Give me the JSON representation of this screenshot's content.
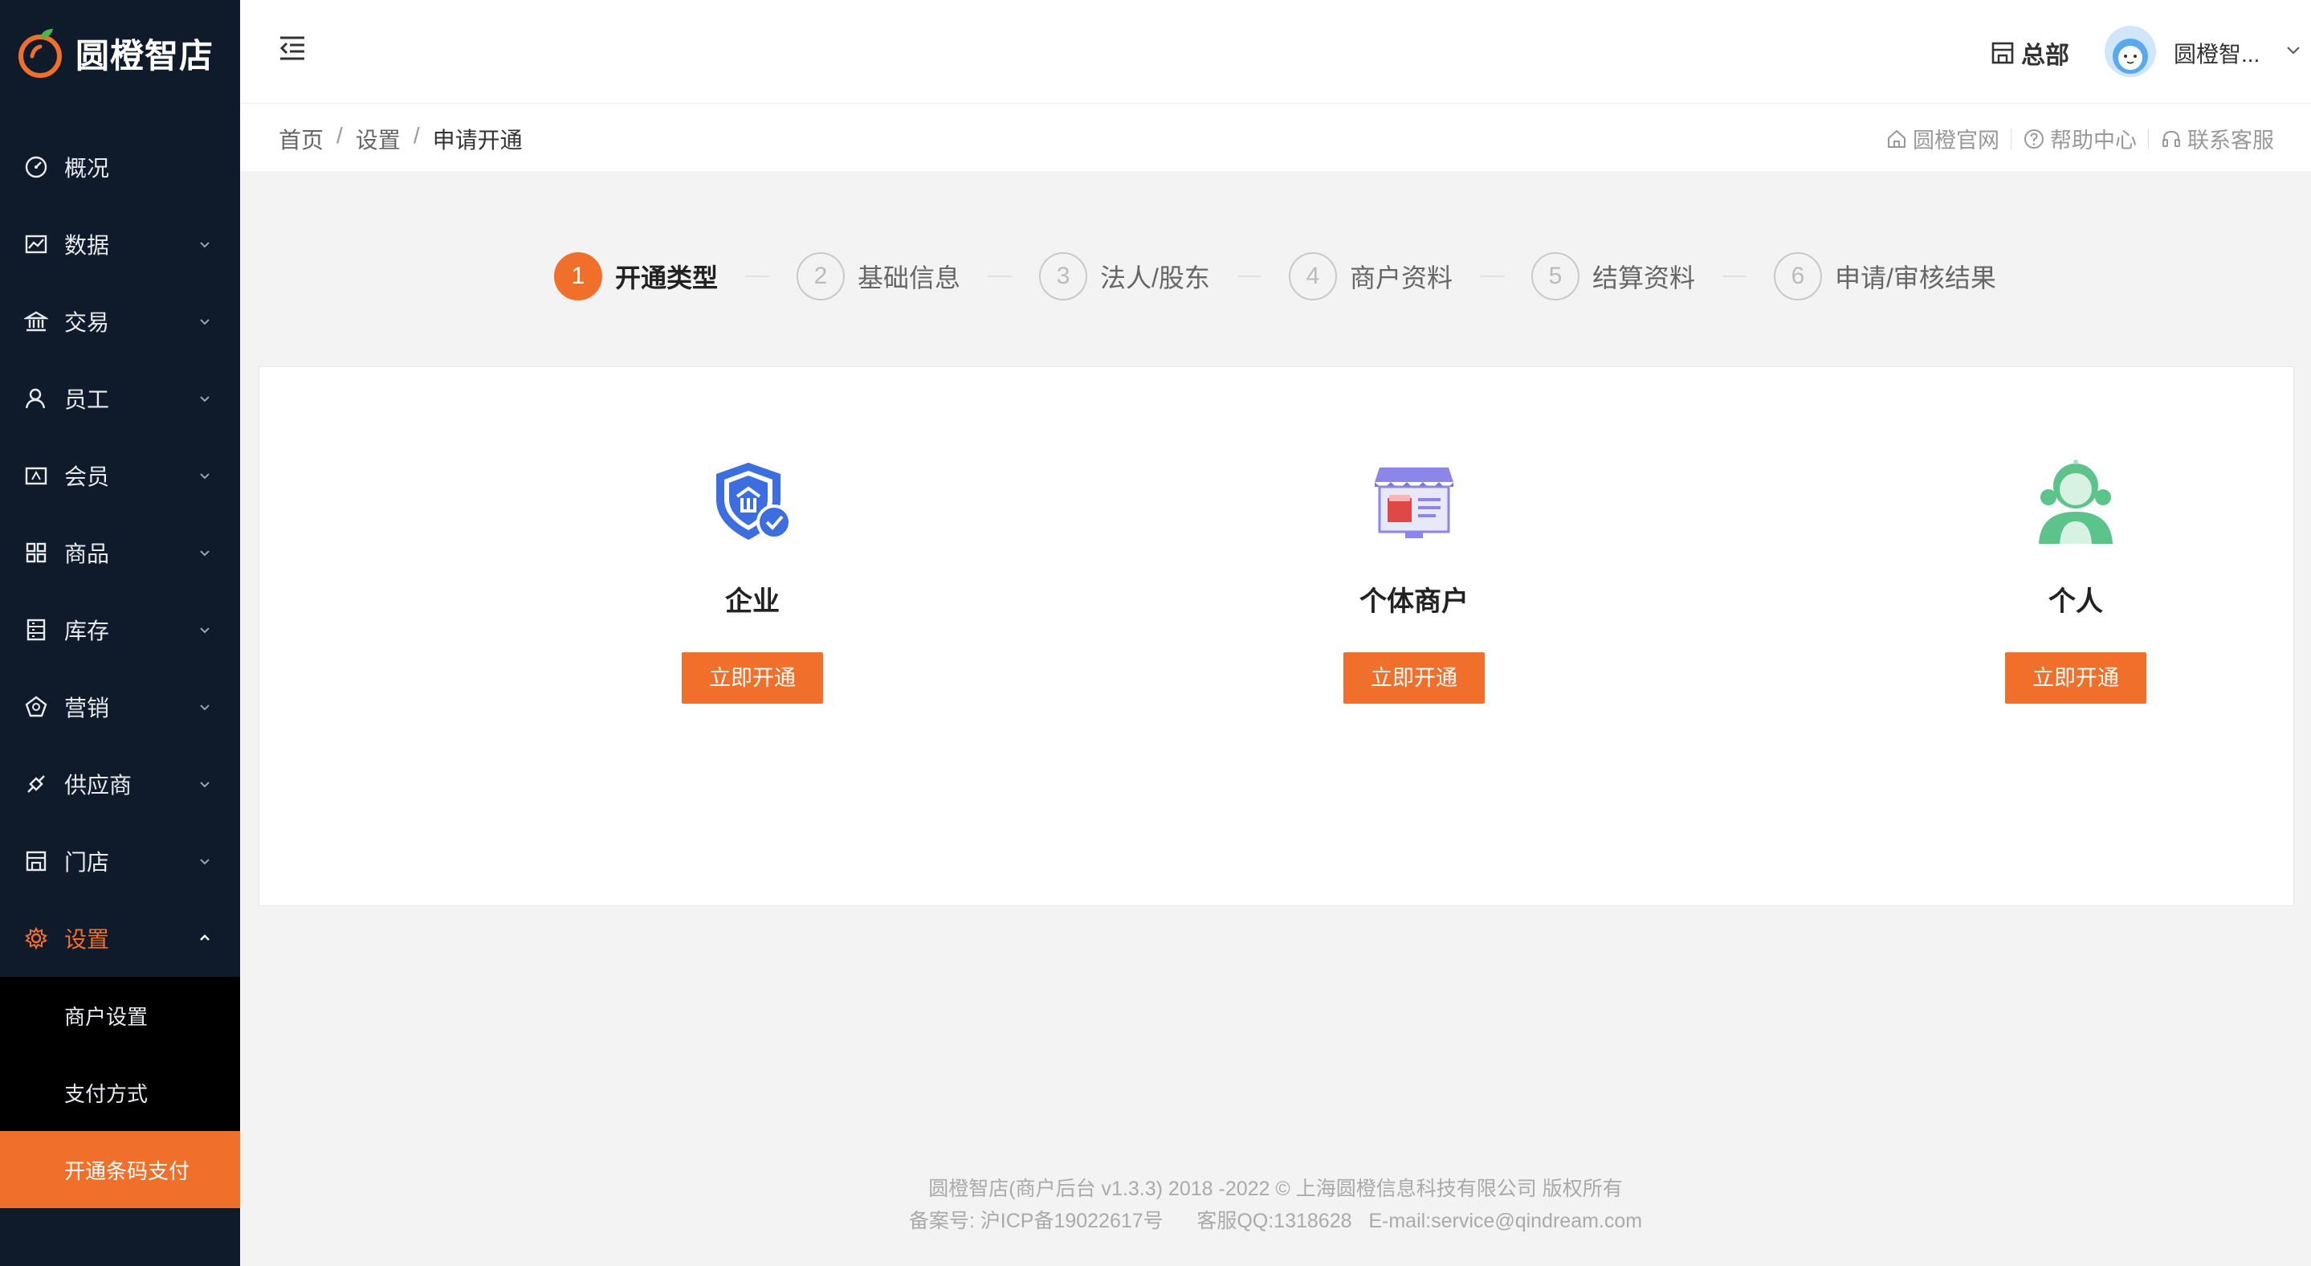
{
  "brand": {
    "name": "圆橙智店"
  },
  "sidebar": {
    "items": [
      {
        "label": "概况",
        "icon": "dashboard-icon"
      },
      {
        "label": "数据",
        "icon": "chart-icon"
      },
      {
        "label": "交易",
        "icon": "bank-icon"
      },
      {
        "label": "员工",
        "icon": "person-icon"
      },
      {
        "label": "会员",
        "icon": "member-card-icon"
      },
      {
        "label": "商品",
        "icon": "grid-icon"
      },
      {
        "label": "库存",
        "icon": "inventory-icon"
      },
      {
        "label": "营销",
        "icon": "marketing-icon"
      },
      {
        "label": "供应商",
        "icon": "supplier-icon"
      },
      {
        "label": "门店",
        "icon": "store-icon"
      },
      {
        "label": "设置",
        "icon": "gear-icon"
      }
    ],
    "submenu": [
      {
        "label": "商户设置"
      },
      {
        "label": "支付方式"
      },
      {
        "label": "开通条码支付"
      }
    ]
  },
  "header": {
    "store": "总部",
    "username": "圆橙智..."
  },
  "breadcrumb": {
    "home": "首页",
    "settings": "设置",
    "current": "申请开通",
    "sep": "/"
  },
  "quick_links": {
    "official": "圆橙官网",
    "help": "帮助中心",
    "service": "联系客服"
  },
  "steps": [
    {
      "num": "1",
      "label": "开通类型"
    },
    {
      "num": "2",
      "label": "基础信息"
    },
    {
      "num": "3",
      "label": "法人/股东"
    },
    {
      "num": "4",
      "label": "商户资料"
    },
    {
      "num": "5",
      "label": "结算资料"
    },
    {
      "num": "6",
      "label": "申请/审核结果"
    }
  ],
  "options": [
    {
      "title": "企业",
      "button": "立即开通"
    },
    {
      "title": "个体商户",
      "button": "立即开通"
    },
    {
      "title": "个人",
      "button": "立即开通"
    }
  ],
  "footer": {
    "line1": "圆橙智店(商户后台 v1.3.3) 2018 -2022 © 上海圆橙信息科技有限公司 版权所有",
    "line2": "备案号: 沪ICP备19022617号      客服QQ:1318628   E-mail:service@qindream.com"
  },
  "colors": {
    "accent": "#f06f2a",
    "sidebar": "#0f1a2a"
  }
}
